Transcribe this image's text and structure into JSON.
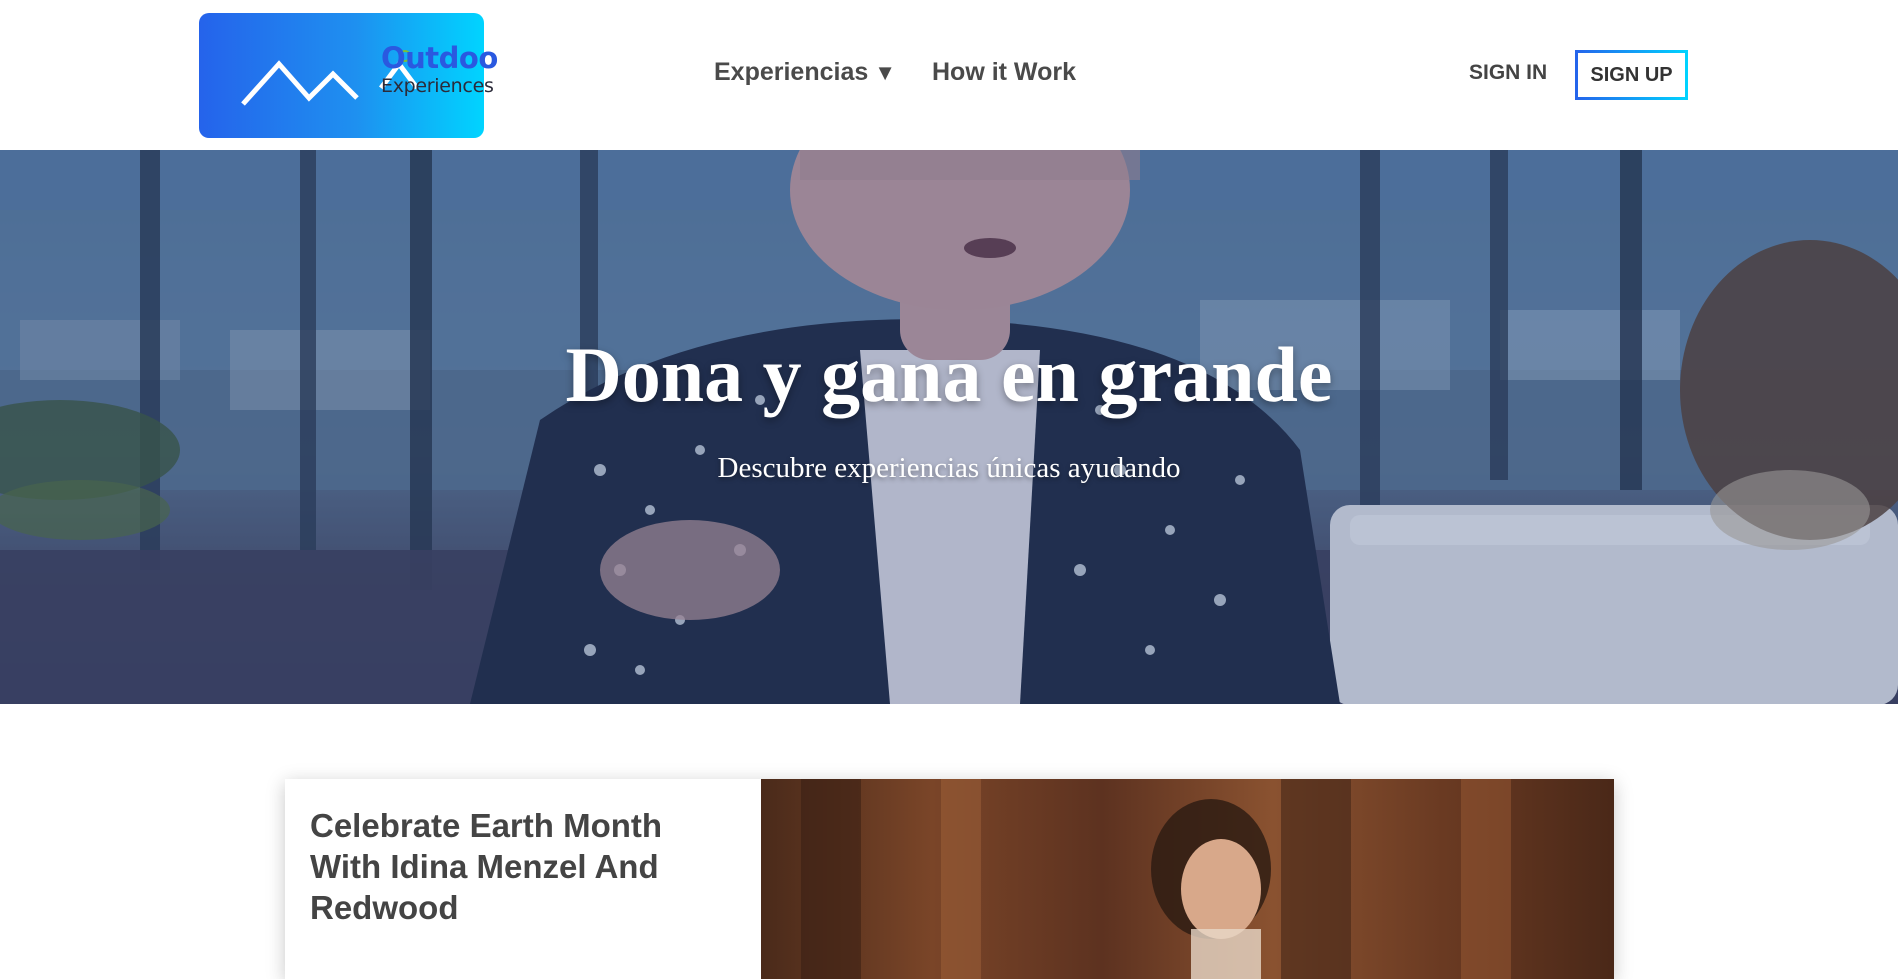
{
  "header": {
    "logo": {
      "line1": "Outdoor",
      "line2": "Experiences"
    },
    "nav": {
      "experiencias_label": "Experiencias",
      "experiencias_caret": "▼",
      "how_label": "How it Work"
    },
    "signin_label": "SIGN IN",
    "signup_label": "SIGN UP"
  },
  "hero": {
    "title": "Dona y gana en grande",
    "subtitle": "Descubre experiencias únicas ayudando"
  },
  "feature": {
    "title": "Celebrate Earth Month With Idina Menzel And Redwood"
  },
  "colors": {
    "brand_gradient_start": "#2563eb",
    "brand_gradient_end": "#00d4ff",
    "nav_text": "#4a4a4a",
    "heading_text": "#444444"
  }
}
